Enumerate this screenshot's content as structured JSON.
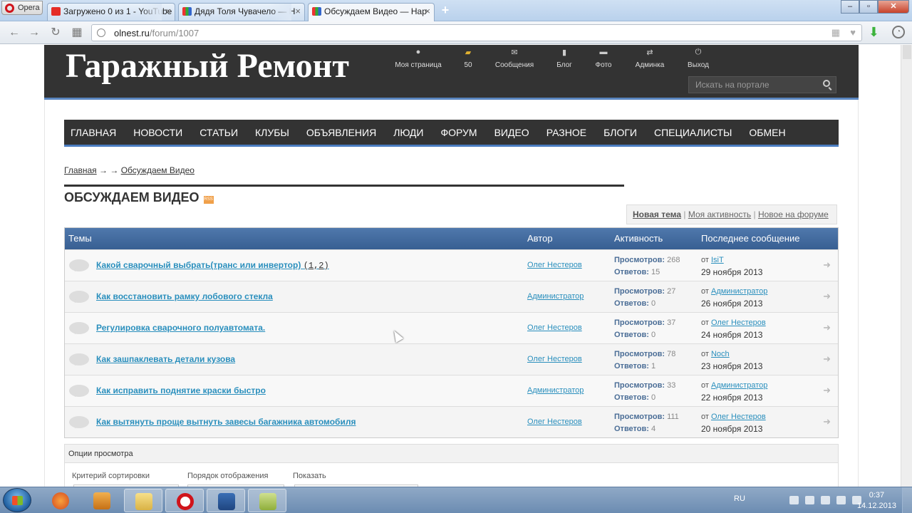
{
  "browser": {
    "menu_label": "Opera",
    "tabs": [
      {
        "label": "Загружено 0 из 1 - YouTube",
        "active": false
      },
      {
        "label": "Дядя Толя Чувачело — Н",
        "active": false
      },
      {
        "label": "Обсуждаем Видео — Нар",
        "active": true
      }
    ],
    "url_host": "olnest.ru",
    "url_path": "/forum/1007"
  },
  "site": {
    "logo": "Гаражный Ремонт",
    "user_nav": [
      {
        "label": "Моя страница",
        "icon": "user-icon"
      },
      {
        "label": "50",
        "icon": "coins-icon"
      },
      {
        "label": "Сообщения",
        "icon": "mail-icon"
      },
      {
        "label": "Блог",
        "icon": "blog-icon"
      },
      {
        "label": "Фото",
        "icon": "photo-icon"
      },
      {
        "label": "Админка",
        "icon": "admin-icon"
      },
      {
        "label": "Выход",
        "icon": "power-icon"
      }
    ],
    "search_placeholder": "Искать на портале",
    "main_nav": [
      "ГЛАВНАЯ",
      "НОВОСТИ",
      "СТАТЬИ",
      "КЛУБЫ",
      "ОБЪЯВЛЕНИЯ",
      "ЛЮДИ",
      "ФОРУМ",
      "ВИДЕО",
      "РАЗНОЕ",
      "БЛОГИ",
      "СПЕЦИАЛИСТЫ",
      "ОБМЕН"
    ]
  },
  "breadcrumb": {
    "home": "Главная",
    "separator": "→ →",
    "current": "Обсуждаем Видео"
  },
  "page_title": "ОБСУЖДАЕМ ВИДЕО",
  "rss_label": "RSS",
  "actions": {
    "new_topic": "Новая тема",
    "my_activity": "Моя активность",
    "new_on_forum": "Новое на форуме"
  },
  "table": {
    "headers": {
      "topics": "Темы",
      "author": "Автор",
      "activity": "Активность",
      "last": "Последнее сообщение"
    },
    "views_label": "Просмотров:",
    "replies_label": "Ответов:",
    "from_label": "от",
    "rows": [
      {
        "title": "Какой сварочный выбрать(транс или инвертор)",
        "pages": [
          "1",
          "2"
        ],
        "author": "Олег Нестеров",
        "views": "268",
        "replies": "15",
        "last_by": "IsiT",
        "last_date": "29 ноября 2013"
      },
      {
        "title": "Как восстановить рамку лобового стекла",
        "pages": [],
        "author": "Администратор",
        "views": "27",
        "replies": "0",
        "last_by": "Администратор",
        "last_date": "26 ноября 2013"
      },
      {
        "title": "Регулировка сварочного полуавтомата.",
        "pages": [],
        "author": "Олег Нестеров",
        "views": "37",
        "replies": "0",
        "last_by": "Олег Нестеров",
        "last_date": "24 ноября 2013"
      },
      {
        "title": "Как зашпаклевать детали кузова",
        "pages": [],
        "author": "Олег Нестеров",
        "views": "78",
        "replies": "1",
        "last_by": "Noch",
        "last_date": "23 ноября 2013"
      },
      {
        "title": "Как исправить поднятие краски быстро",
        "pages": [],
        "author": "Администратор",
        "views": "33",
        "replies": "0",
        "last_by": "Администратор",
        "last_date": "22 ноября 2013"
      },
      {
        "title": "Как вытянуть проще вытнуть завесы багажника автомобиля",
        "pages": [],
        "author": "Олег Нестеров",
        "views": "111",
        "replies": "4",
        "last_by": "Олег Нестеров",
        "last_date": "20 ноября 2013"
      }
    ]
  },
  "view_options": {
    "header": "Опции просмотра",
    "sort_label": "Критерий сортировки",
    "order_label": "Порядок отображения",
    "show_label": "Показать"
  },
  "taskbar": {
    "lang": "RU",
    "time": "0:37",
    "date": "14.12.2013"
  }
}
